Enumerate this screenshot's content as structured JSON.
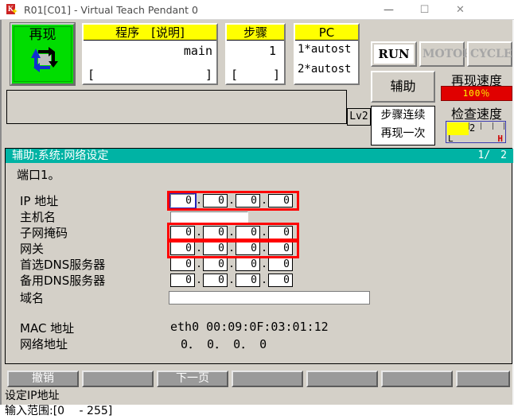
{
  "window": {
    "title": "R01[C01] - Virtual Teach Pendant 0",
    "minimize": "—",
    "maximize": "☐",
    "close": "✕",
    "icon": "app-icon"
  },
  "toolbar": {
    "mode_button": {
      "label": "再现",
      "icon": "cycle-loop-icon",
      "color": "#00dd00"
    },
    "program_card": {
      "caption": "程序　[说明]",
      "value": "main",
      "bracket_left": "[",
      "bracket_right": "]"
    },
    "step_card": {
      "caption": "步骤",
      "value": "1",
      "bracket_left": "[",
      "bracket_right": "]"
    },
    "pc_card": {
      "caption": "PC",
      "line1": "1*autost",
      "line2": "2*autost"
    },
    "level_tag": "Lv2",
    "lamps": [
      {
        "label": "RUN",
        "active": true
      },
      {
        "label": "MOTOR",
        "active": false
      },
      {
        "label": "CYCLE",
        "active": false
      }
    ],
    "aux_button": "辅助",
    "mode_detail": {
      "line1": "步骤连续",
      "line2": "再现一次"
    },
    "play_speed": {
      "label": "再现速度",
      "value": "100％",
      "bar_color": "#e00000",
      "text_color": "#ffff00"
    },
    "check_speed": {
      "label": "检查速度",
      "value": "2",
      "low_mark": "L",
      "high_mark": "H",
      "fill_color": "#ffff00"
    }
  },
  "content": {
    "breadcrumb": "辅助:系统:网络设定",
    "page_indicator": "1/　2",
    "port_line": "端口1。",
    "fields": [
      {
        "label": "IP 地址",
        "type": "octets",
        "octets": [
          "0",
          "0",
          "0",
          "0"
        ],
        "focused_index": 0,
        "highlighted": true
      },
      {
        "label": "主机名",
        "type": "text",
        "value": "",
        "highlighted": false
      },
      {
        "label": "子网掩码",
        "type": "octets",
        "octets": [
          "0",
          "0",
          "0",
          "0"
        ],
        "focused_index": -1,
        "highlighted": true
      },
      {
        "label": "网关",
        "type": "octets",
        "octets": [
          "0",
          "0",
          "0",
          "0"
        ],
        "focused_index": -1,
        "highlighted": true
      },
      {
        "label": "首选DNS服务器",
        "type": "octets",
        "octets": [
          "0",
          "0",
          "0",
          "0"
        ],
        "focused_index": -1,
        "highlighted": false
      },
      {
        "label": "备用DNS服务器",
        "type": "octets",
        "octets": [
          "0",
          "0",
          "0",
          "0"
        ],
        "focused_index": -1,
        "highlighted": false
      },
      {
        "label": "域名",
        "type": "text",
        "value": "",
        "highlighted": false
      }
    ],
    "readonly": [
      {
        "label": "MAC 地址",
        "value": "eth0 00:09:0F:03:01:12"
      },
      {
        "label": "网络地址",
        "value": "0． 0． 0． 0"
      }
    ]
  },
  "softkeys": [
    {
      "label": "撤销"
    },
    {
      "label": ""
    },
    {
      "label": "下一页"
    },
    {
      "label": ""
    },
    {
      "label": ""
    },
    {
      "label": ""
    },
    {
      "label": ""
    }
  ],
  "status": {
    "line1": "设定IP地址",
    "line2": "输入范围:[0  - 255]"
  },
  "colors": {
    "accent_teal": "#00b3a4",
    "caption_yellow": "#ffff00",
    "mode_green": "#00dd00",
    "highlight_red": "#ff0000",
    "panel_gray": "#d4d0c8",
    "softkey_gray": "#9a9a9a"
  }
}
